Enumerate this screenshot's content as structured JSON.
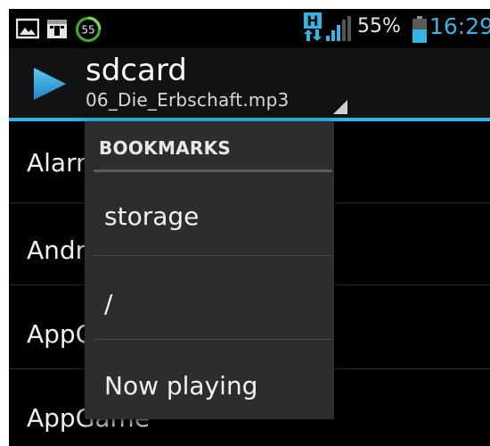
{
  "status_bar": {
    "notification_icons": [
      "picture-icon",
      "calendar-icon",
      "timer-55-icon"
    ],
    "timer_badge": "55",
    "network_badge": "H",
    "battery_percent": "55%",
    "clock": "16:29"
  },
  "action_bar": {
    "title": "sdcard",
    "subtitle": "06_Die_Erbschaft.mp3"
  },
  "file_list": {
    "items": [
      "Alarms",
      "Android",
      "AppGame",
      "AppGame"
    ]
  },
  "bookmarks_menu": {
    "header": "BOOKMARKS",
    "items": [
      "storage",
      "/",
      "Now playing"
    ]
  },
  "colors": {
    "accent": "#33b5e5",
    "battery": "#33b5e5",
    "timer_green": "#3fae2a"
  }
}
